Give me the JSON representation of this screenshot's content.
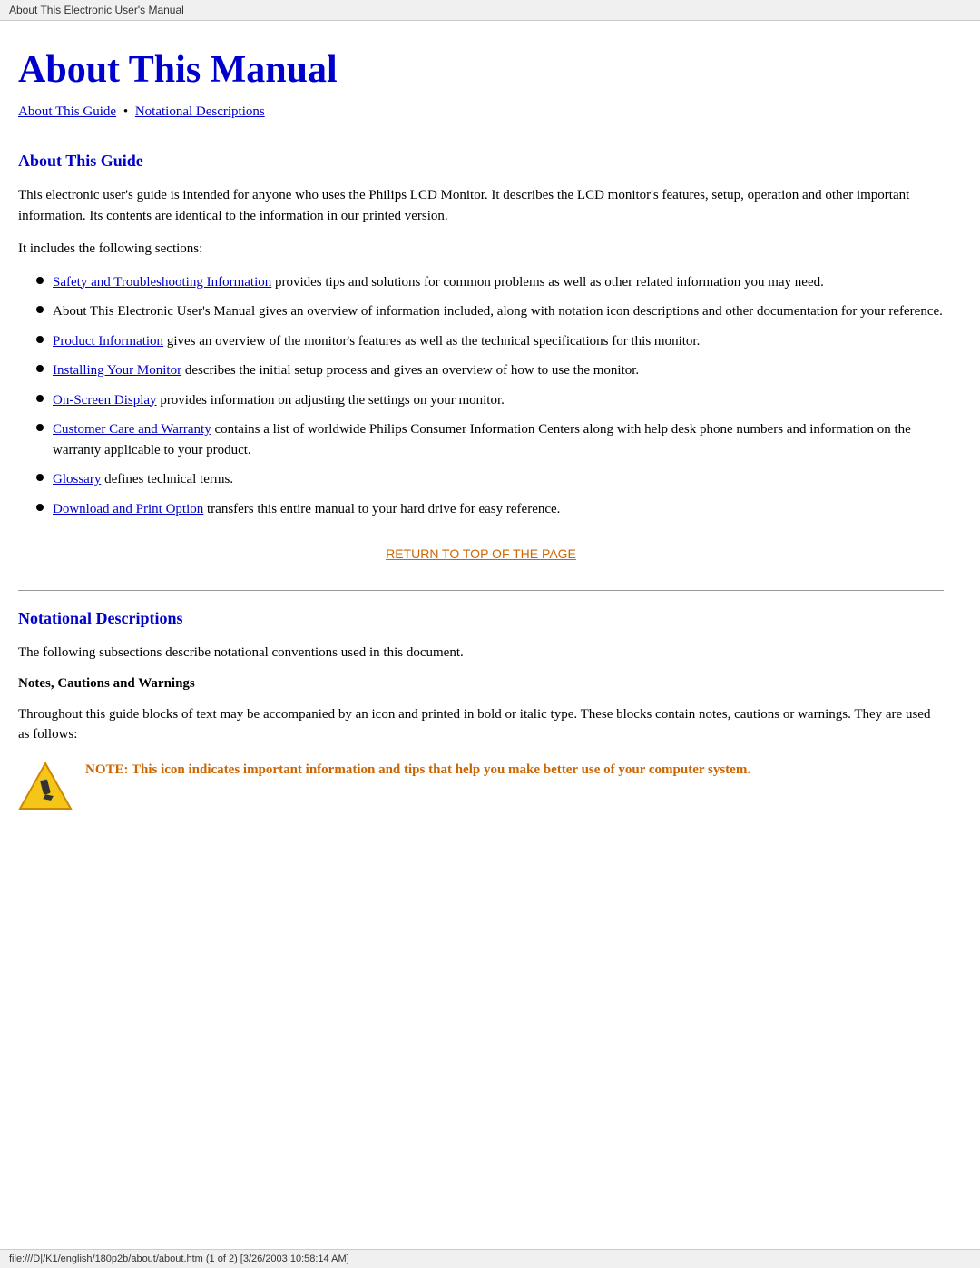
{
  "browser": {
    "tab_title": "About This Electronic User's Manual",
    "footer_url": "file:///D|/K1/english/180p2b/about/about.htm (1 of 2) [3/26/2003 10:58:14 AM]"
  },
  "page": {
    "title": "About This Manual",
    "nav": {
      "link1_label": "About This Guide",
      "separator": "•",
      "link2_label": "Notational Descriptions"
    },
    "section1": {
      "heading": "About This Guide",
      "intro_para1": "This electronic user's guide is intended for anyone who uses the Philips LCD Monitor. It describes the LCD monitor's features, setup, operation and other important information. Its contents are identical to the information in our printed version.",
      "intro_para2": "It includes the following sections:",
      "bullets": [
        {
          "link_text": "Safety and Troubleshooting Information",
          "rest_text": " provides tips and solutions for common problems as well as other related information you may need."
        },
        {
          "link_text": null,
          "rest_text": "About This Electronic User's Manual gives an overview of information included, along with notation icon descriptions and other documentation for your reference."
        },
        {
          "link_text": "Product Information",
          "rest_text": " gives an overview of the monitor's features as well as the technical specifications for this monitor."
        },
        {
          "link_text": "Installing Your Monitor",
          "rest_text": " describes the initial setup process and gives an overview of how to use the monitor."
        },
        {
          "link_text": "On-Screen Display",
          "rest_text": " provides information on adjusting the settings on your monitor."
        },
        {
          "link_text": "Customer Care and Warranty",
          "rest_text": " contains a list of worldwide Philips Consumer Information Centers along with help desk phone numbers and information on the warranty applicable to your product."
        },
        {
          "link_text": "Glossary",
          "rest_text": " defines technical terms."
        },
        {
          "link_text": "Download and Print Option",
          "rest_text": " transfers this entire manual to your hard drive for easy reference."
        }
      ],
      "return_link": "RETURN TO TOP OF THE PAGE"
    },
    "section2": {
      "heading": "Notational Descriptions",
      "intro_para": "The following subsections describe notational conventions used in this document.",
      "notes_heading": "Notes, Cautions and Warnings",
      "notes_para": "Throughout this guide blocks of text may be accompanied by an icon and printed in bold or italic type. These blocks contain notes, cautions or warnings. They are used as follows:",
      "note_text": "NOTE: This icon indicates important information and tips that help you make better use of your computer system."
    }
  },
  "colors": {
    "title_blue": "#0000cc",
    "link_blue": "#0000cc",
    "return_orange": "#cc6600",
    "note_orange": "#cc6600",
    "heading_blue": "#0000cc"
  }
}
